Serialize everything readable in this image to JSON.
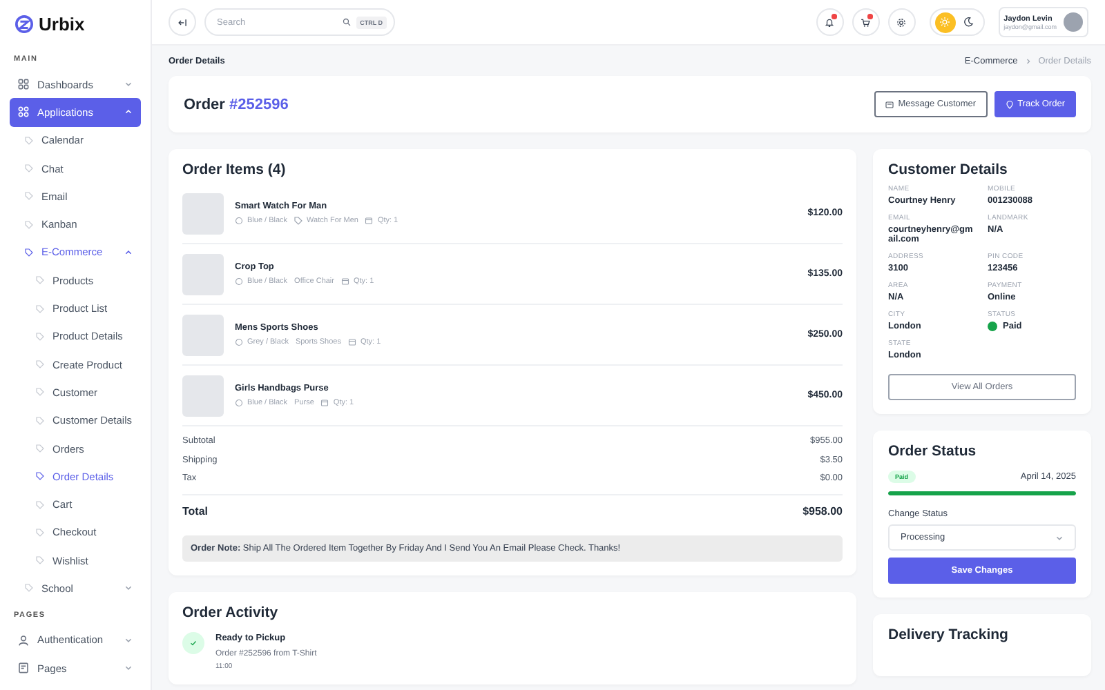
{
  "sidebar": {
    "logo": "Urbix",
    "sections": [
      {
        "label": "MAIN",
        "items": [
          {
            "label": "Dashboards",
            "selected": false,
            "expanded": false
          },
          {
            "label": "Applications",
            "selected": true,
            "expanded": true,
            "children": [
              {
                "label": "Calendar",
                "selected": false
              },
              {
                "label": "Chat",
                "selected": false
              },
              {
                "label": "Email",
                "selected": false
              },
              {
                "label": "Kanban",
                "selected": false
              },
              {
                "label": "E-Commerce",
                "selected": true,
                "expanded": true,
                "children": [
                  {
                    "label": "Products",
                    "selected": false
                  },
                  {
                    "label": "Product List",
                    "selected": false
                  },
                  {
                    "label": "Product Details",
                    "selected": false
                  },
                  {
                    "label": "Create Product",
                    "selected": false
                  },
                  {
                    "label": "Customer",
                    "selected": false
                  },
                  {
                    "label": "Customer Details",
                    "selected": false
                  },
                  {
                    "label": "Orders",
                    "selected": false
                  },
                  {
                    "label": "Order Details",
                    "selected": true
                  },
                  {
                    "label": "Cart",
                    "selected": false
                  },
                  {
                    "label": "Checkout",
                    "selected": false
                  },
                  {
                    "label": "Wishlist",
                    "selected": false
                  }
                ]
              },
              {
                "label": "School",
                "selected": false,
                "expanded": false
              }
            ]
          }
        ]
      },
      {
        "label": "PAGES",
        "items": [
          {
            "label": "Authentication",
            "selected": false,
            "expanded": false
          },
          {
            "label": "Pages",
            "selected": false,
            "expanded": false
          }
        ]
      }
    ]
  },
  "topbar": {
    "search": {
      "placeholder": "Search",
      "shortcut": "CTRL D"
    },
    "notifications": {
      "badge": true
    },
    "cart": {
      "badge": true
    },
    "theme_toggle": [
      {
        "kind": "sun",
        "selected": true
      },
      {
        "kind": "moon",
        "selected": false
      }
    ],
    "user": {
      "name": "Jaydon Levin",
      "email": "jaydon@gmail.com"
    }
  },
  "page_title": "Order Details",
  "breadcrumb": [
    {
      "label": "E-Commerce",
      "selected": false
    },
    {
      "label": "Order Details",
      "selected": true
    }
  ],
  "order_header": {
    "title": "Order",
    "number": "#252596",
    "buttons": [
      {
        "label": "Message Customer",
        "kind": "outline"
      },
      {
        "label": "Track Order",
        "kind": "primary"
      }
    ]
  },
  "order_items": {
    "title": "Order Items (4)",
    "items": [
      {
        "name": "Smart Watch For Man",
        "variant": "Blue / Black",
        "category": "Watch For Men",
        "category_icon": true,
        "qty": "Qty: 1",
        "price": "$120.00"
      },
      {
        "name": "Crop Top",
        "variant": "Blue / Black",
        "category": "Office Chair",
        "category_icon": false,
        "qty": "Qty: 1",
        "price": "$135.00"
      },
      {
        "name": "Mens Sports Shoes",
        "variant": "Grey / Black",
        "category": "Sports Shoes",
        "category_icon": false,
        "qty": "Qty: 1",
        "price": "$250.00"
      },
      {
        "name": "Girls Handbags Purse",
        "variant": "Blue / Black",
        "category": "Purse",
        "category_icon": false,
        "qty": "Qty: 1",
        "price": "$450.00"
      }
    ],
    "totals": [
      {
        "label": "Subtotal",
        "value": "$955.00"
      },
      {
        "label": "Shipping",
        "value": "$3.50"
      },
      {
        "label": "Tax",
        "value": "$0.00"
      }
    ],
    "total": {
      "label": "Total",
      "value": "$958.00"
    },
    "note": "**Order Note:** Ship All The Ordered Item Together By Friday And I Send You An Email Please Check. Thanks!"
  },
  "order_activity": {
    "title": "Order Activity",
    "events": [
      {
        "title": "Ready to Pickup",
        "detail": "Order #252596 from T-Shirt",
        "time": "11:00",
        "done": true
      }
    ]
  },
  "customer_details": {
    "title": "Customer Details",
    "fields": [
      {
        "label": "NAME",
        "value": "Courtney Henry"
      },
      {
        "label": "MOBILE",
        "value": "001230088"
      },
      {
        "label": "EMAIL",
        "value": "courtneyhenry@gmail.com"
      },
      {
        "label": "LANDMARK",
        "value": "N/A"
      },
      {
        "label": "ADDRESS",
        "value": "3100"
      },
      {
        "label": "PIN CODE",
        "value": "123456"
      },
      {
        "label": "AREA",
        "value": "N/A"
      },
      {
        "label": "PAYMENT",
        "value": "Online"
      },
      {
        "label": "CITY",
        "value": "London"
      },
      {
        "label": "STATUS",
        "value": "Paid",
        "color": "#16a34a"
      },
      {
        "label": "STATE",
        "value": "London"
      }
    ],
    "button": "View All Orders"
  },
  "order_status": {
    "title": "Order Status",
    "badge": "Paid",
    "date": "April 14, 2025",
    "level": 1,
    "change_label": "Change Status",
    "select_value": "Processing",
    "button": "Save Changes"
  },
  "delivery_tracking": {
    "title": "Delivery Tracking"
  }
}
